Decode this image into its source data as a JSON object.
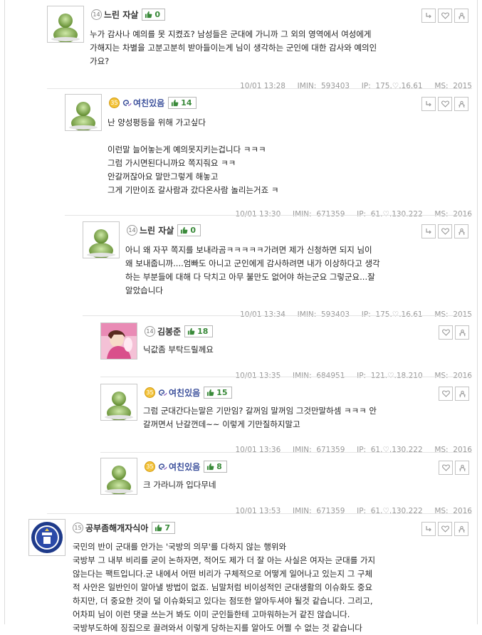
{
  "comments": [
    {
      "level": "14",
      "nick": "느린 자살",
      "likes": "0",
      "body": "누가 감사나 예의를 못 지켰죠? 남성들은 군대에 가니까 그 외의 영역에서 여성에게\n가해지는 차별을 고분고분히 받아들이는게 님이 생각하는 군인에 대한 감사와 예의인\n가요?",
      "date": "10/01 13:28",
      "imin": "IMIN:  593403",
      "ip": "IP:  175.♡.16.61",
      "ms": "MS:  2015"
    },
    {
      "level": "35",
      "nick": "여친있음",
      "likes": "14",
      "body": "난 양성평등을 위해 가고싶다\n\n이런말 늘어놓는게 예의못지키는겁니다 ㅋㅋㅋ\n그럼 가시면된다니까요 쪽지줘요 ㅋㅋ\n안갈꺼잖아요 말만그렇게 해놓고\n그게 기만이죠 갈사람과 갔다온사람 놀리는거죠 ㅋ",
      "date": "10/01 13:30",
      "imin": "IMIN:  671359",
      "ip": "IP:  61.♡.130.222",
      "ms": "MS:  2016"
    },
    {
      "level": "14",
      "nick": "느린 자살",
      "likes": "0",
      "body": "아니 왜 자꾸 쪽지를 보내라곰ㅋㅋㅋㅋㅋ가려면 제가 신청하면 되지 님이\n왜 보내줍니까....엄빠도 아니고 군인에게 감사하려면 내가 이상하다고 생각\n하는 부분들에 대해 다 닥치고 아무 불만도 없어야 하는군요 그렇군요...잘\n알았습니다",
      "date": "10/01 13:34",
      "imin": "IMIN:  593403",
      "ip": "IP:  175.♡.16.61",
      "ms": "MS:  2015"
    },
    {
      "level": "14",
      "nick": "김봉준",
      "likes": "18",
      "body": "닉값좀 부탁드릴께요",
      "date": "10/01 13:35",
      "imin": "IMIN:  684951",
      "ip": "IP:  121.♡.18.210",
      "ms": "MS:  2016"
    },
    {
      "level": "35",
      "nick": "여친있음",
      "likes": "15",
      "body": "그럼 군대간다는말은 기만임? 갈꺼임 말꺼임 그것만말하셈 ㅋㅋㅋ 안\n갈꺼면서 난갈껀데~~ 이렇게 기만질하지말고",
      "date": "10/01 13:36",
      "imin": "IMIN:  671359",
      "ip": "IP:  61.♡.130.222",
      "ms": "MS:  2016"
    },
    {
      "level": "35",
      "nick": "여친있음",
      "likes": "8",
      "body": "크 가라니까 입다무네",
      "date": "10/01 13:53",
      "imin": "IMIN:  671359",
      "ip": "IP:  61.♡.130.222",
      "ms": "MS:  2016"
    },
    {
      "level": "15",
      "nick": "공부좀해개자식아",
      "likes": "7",
      "body": "국민의 반이 군대를 안가는 '국방의 의무'를 다하지 않는 행위와\n국방부 그 내부 비리를 굳이 논하자면, 적어도 제가 더 잘 아는 사실은 여자는 군대를 가지\n않는다는 팩트입니다.군 내에서 어떤 비리가 구체적으로 어떻게 일어나고 있는지 그 구체\n적 사안은 일반인이 알아낼 방법이 없죠. 님말처럼 비이성적인 군대생활의 이슈화도 중요\n하지만, 더 중요한 것이 덜 이슈화되고 있다는 점또한 알아두셔야 될것 같습니다. 그리고,\n어차피 님이 이런 댓글 쓰는거 봐도 이미 군인들한테 고마워하는거 같진 않습니다.\n국방부도하에 징집으로 끌려와서 이렇게 당하는지를 알아도 어쩔 수 없는 것 같습니다"
    }
  ],
  "colors": {
    "like_green": "#3a8a3a",
    "nick_blue": "#3b4f9b",
    "meta_gray": "#999999"
  },
  "icons": [
    "reply-icon",
    "heart-icon",
    "report-icon",
    "thumbs-up-icon",
    "default-avatar-icon",
    "swirl-icon",
    "level-badge-icon"
  ]
}
